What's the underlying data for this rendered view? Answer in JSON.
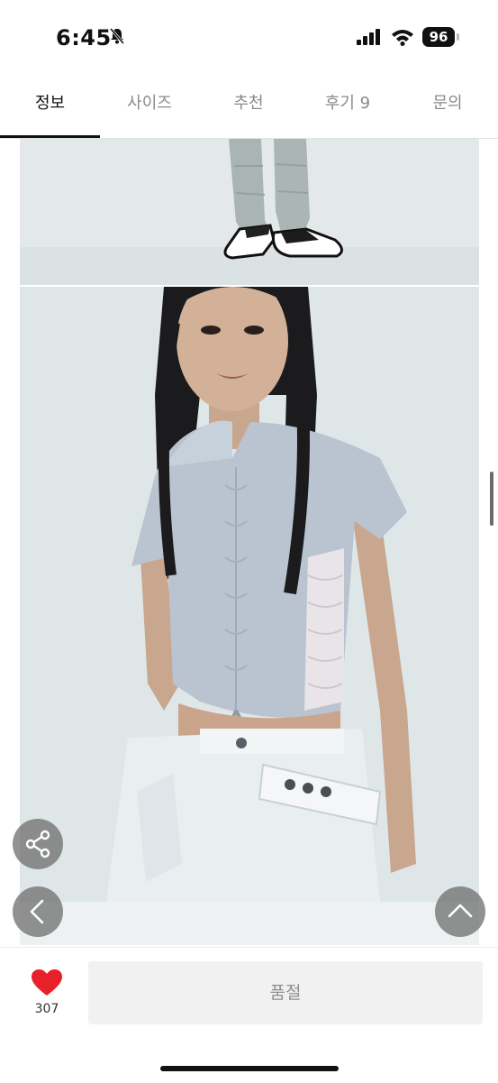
{
  "status": {
    "time": "6:45",
    "battery": "96"
  },
  "tabs": [
    {
      "label": "정보"
    },
    {
      "label": "사이즈"
    },
    {
      "label": "추천"
    },
    {
      "label": "후기 9"
    },
    {
      "label": "문의"
    }
  ],
  "actions": {
    "like_count": "307",
    "soldout_label": "품절"
  },
  "icons": {
    "share": "share-icon",
    "back": "chevron-left-icon",
    "top": "chevron-up-icon",
    "like": "heart-icon"
  },
  "colors": {
    "heart": "#e8202a",
    "active_tab": "#111111",
    "inactive_tab": "#8a8a8a"
  }
}
